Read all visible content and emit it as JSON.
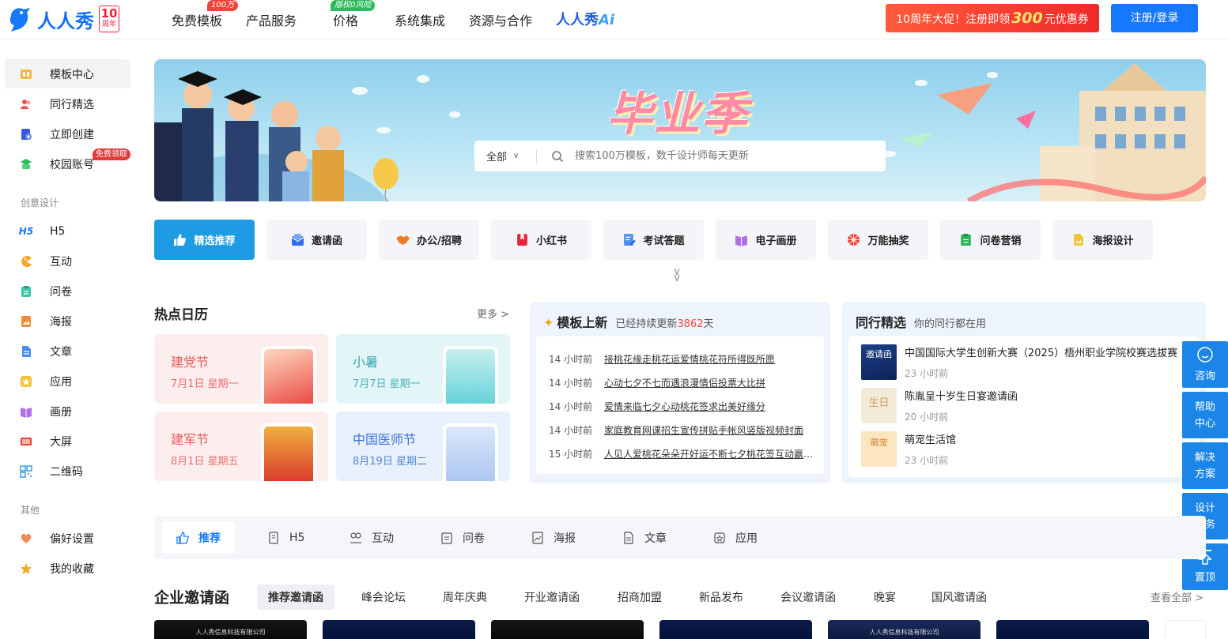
{
  "header": {
    "logo_text": "人人秀",
    "logo_badge_num": "10",
    "logo_badge_sub": "周年",
    "nav": [
      {
        "label": "免费模板",
        "tag": "100万"
      },
      {
        "label": "产品服务"
      },
      {
        "label": "价格",
        "tag": "版权0风险"
      },
      {
        "label": "系统集成"
      },
      {
        "label": "资源与合作"
      }
    ],
    "ai_label": "人人秀",
    "ai_suffix": "Ai",
    "promo_prefix": "10周年大促！注册即领",
    "promo_amount": "300",
    "promo_suffix": "元优惠券",
    "login_label": "注册/登录",
    "colors": {
      "primary": "#1677ff",
      "promo": "#f0362a"
    }
  },
  "sidebar": {
    "main": [
      {
        "label": "模板中心",
        "icon": "template-icon"
      },
      {
        "label": "同行精选",
        "icon": "peers-icon"
      },
      {
        "label": "立即创建",
        "icon": "create-icon"
      },
      {
        "label": "校园账号",
        "icon": "campus-icon",
        "badge": "免费领取"
      }
    ],
    "group1_title": "创意设计",
    "design": [
      {
        "label": "H5",
        "icon": "h5-icon"
      },
      {
        "label": "互动",
        "icon": "interact-icon"
      },
      {
        "label": "问卷",
        "icon": "survey-icon"
      },
      {
        "label": "海报",
        "icon": "poster-icon"
      },
      {
        "label": "文章",
        "icon": "article-icon"
      },
      {
        "label": "应用",
        "icon": "app-icon"
      },
      {
        "label": "画册",
        "icon": "album-icon"
      },
      {
        "label": "大屏",
        "icon": "screen-icon"
      },
      {
        "label": "二维码",
        "icon": "qrcode-icon"
      }
    ],
    "group2_title": "其他",
    "other": [
      {
        "label": "偏好设置",
        "icon": "heart-icon"
      },
      {
        "label": "我的收藏",
        "icon": "star-icon"
      }
    ]
  },
  "banner": {
    "title": "毕业季",
    "search_scope": "全部",
    "search_placeholder": "搜索100万模板，数千设计师每天更新"
  },
  "categories": [
    {
      "label": "精选推荐",
      "icon": "thumbs-up-icon",
      "color": "#ffffff"
    },
    {
      "label": "邀请函",
      "icon": "envelope-icon",
      "color": "#2f6fe8"
    },
    {
      "label": "办公/招聘",
      "icon": "handshake-icon",
      "color": "#f07a2a"
    },
    {
      "label": "小红书",
      "icon": "book-icon",
      "color": "#e8243c"
    },
    {
      "label": "考试答题",
      "icon": "exam-icon",
      "color": "#4a8ef0"
    },
    {
      "label": "电子画册",
      "icon": "album-icon",
      "color": "#b26ee8"
    },
    {
      "label": "万能抽奖",
      "icon": "lottery-icon",
      "color": "#f0463a"
    },
    {
      "label": "问卷营销",
      "icon": "survey-icon",
      "color": "#2db85a"
    },
    {
      "label": "海报设计",
      "icon": "poster-icon",
      "color": "#f5c33a"
    }
  ],
  "hot_calendar": {
    "title": "热点日历",
    "more": "更多 >",
    "items": [
      {
        "name": "建党节",
        "date": "7月1日 星期一",
        "theme": "red"
      },
      {
        "name": "小暑",
        "date": "7月7日 星期一",
        "theme": "teal"
      },
      {
        "name": "建军节",
        "date": "8月1日 星期五",
        "theme": "red"
      },
      {
        "name": "中国医师节",
        "date": "8月19日 星期二",
        "theme": "blue"
      }
    ]
  },
  "new_templates": {
    "title": "模板上新",
    "sub_prefix": "已经持续更新",
    "sub_days": "3862",
    "sub_suffix": "天",
    "rows": [
      {
        "time": "14 小时前",
        "title": "接桃花缘走桃花运爱情桃花符所得既所愿"
      },
      {
        "time": "14 小时前",
        "title": "心动七夕不七而遇浪漫情侣投票大比拼"
      },
      {
        "time": "14 小时前",
        "title": "爱情来临七夕心动桃花签求出美好缘分"
      },
      {
        "time": "14 小时前",
        "title": "家庭教育网课招生宣传拼贴手帐风竖版视频封面"
      },
      {
        "time": "15 小时前",
        "title": "人见人爱桃花朵朵开好运不断七夕桃花签互动赢好礼"
      }
    ]
  },
  "peers": {
    "title": "同行精选",
    "sub": "你的同行都在用",
    "rows": [
      {
        "name": "中国国际大学生创新大赛（2025）梧州职业学院校赛选拔赛",
        "time": "23 小时前",
        "thumb_text": "邀请函"
      },
      {
        "name": "陈胤呈十岁生日宴邀请函",
        "time": "20 小时前",
        "thumb_text": "生日"
      },
      {
        "name": "萌宠生活馆",
        "time": "23 小时前",
        "thumb_text": "萌宠"
      }
    ]
  },
  "float_bar": [
    {
      "label": "咨询",
      "icon": "smile-icon"
    },
    {
      "label": "帮助中心"
    },
    {
      "label": "解决方案"
    },
    {
      "label": "设计服务"
    },
    {
      "label": "置顶",
      "icon": "top-icon"
    }
  ],
  "type_tabs": [
    {
      "label": "推荐",
      "icon": "thumbs-up-icon"
    },
    {
      "label": "H5",
      "icon": "h5-doc-icon"
    },
    {
      "label": "互动",
      "icon": "interact-icon"
    },
    {
      "label": "问卷",
      "icon": "survey-icon"
    },
    {
      "label": "海报",
      "icon": "poster-icon"
    },
    {
      "label": "文章",
      "icon": "article-icon"
    },
    {
      "label": "应用",
      "icon": "app-icon"
    }
  ],
  "enterprise": {
    "title": "企业邀请函",
    "tabs": [
      "推荐邀请函",
      "峰会论坛",
      "周年庆典",
      "开业邀请函",
      "招商加盟",
      "新品发布",
      "会议邀请函",
      "晚宴",
      "国风邀请函"
    ],
    "view_all": "查看全部 >",
    "thumb_caption": "人人秀信息科技有限公司"
  }
}
